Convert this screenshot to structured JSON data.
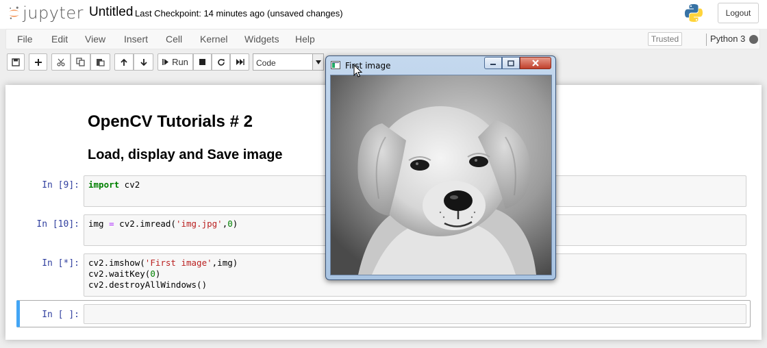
{
  "header": {
    "logo_text": "jupyter",
    "notebook_title": "Untitled",
    "checkpoint": "Last Checkpoint: 14 minutes ago",
    "unsaved": "(unsaved changes)",
    "logout_label": "Logout"
  },
  "menubar": {
    "items": [
      "File",
      "Edit",
      "View",
      "Insert",
      "Cell",
      "Kernel",
      "Widgets",
      "Help"
    ],
    "trusted_label": "Trusted",
    "kernel_name": "Python 3"
  },
  "toolbar": {
    "buttons": [
      "save-icon",
      "plus-icon",
      "cut-icon",
      "copy-icon",
      "paste-icon",
      "arrow-up-icon",
      "arrow-down-icon",
      "run-icon",
      "stop-icon",
      "restart-icon",
      "fast-forward-icon"
    ],
    "run_label": "Run",
    "cell_type": "Code"
  },
  "notebook": {
    "heading1": "OpenCV Tutorials # 2",
    "heading2": "Load, display and Save image",
    "cells": [
      {
        "prompt": "In [9]:",
        "lines": [
          "import cv2"
        ]
      },
      {
        "prompt": "In [10]:",
        "lines": [
          "img = cv2.imread('img.jpg',0)"
        ]
      },
      {
        "prompt": "In [*]:",
        "lines": [
          "cv2.imshow('First image',img)",
          "cv2.waitKey(0)",
          "cv2.destroyAllWindows()"
        ]
      },
      {
        "prompt": "In [ ]:",
        "lines": [
          ""
        ]
      }
    ]
  },
  "window": {
    "title": "First image",
    "image_subject": "grayscale puppy photo"
  },
  "colors": {
    "prompt": "#303f9f",
    "keyword": "#008000",
    "string": "#ba2121",
    "selected_border": "#42a5f5",
    "jupyter_orange": "#f37626"
  }
}
